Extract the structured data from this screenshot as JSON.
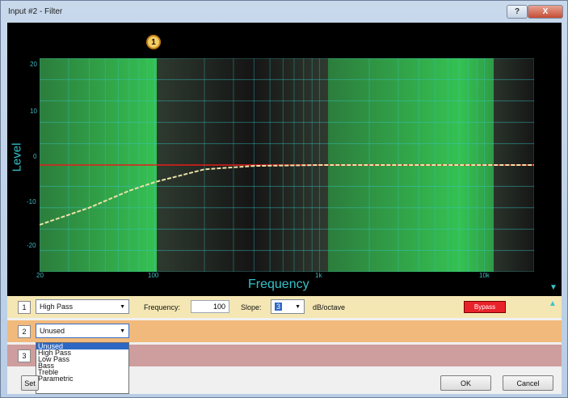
{
  "window": {
    "title": "Input #2 - Filter",
    "help_label": "?",
    "close_label": "X"
  },
  "plot": {
    "marker_label": "1",
    "y_axis_title": "Level",
    "x_axis_title": "Frequency",
    "y_ticks": [
      "20",
      "10",
      "0",
      "-10",
      "-20"
    ],
    "x_ticks": [
      "20",
      "100",
      "1k",
      "10k"
    ],
    "colors": {
      "background": "#000000",
      "band_green": "#31c954",
      "band_dark": "#222622",
      "grid": "#38c8ca",
      "flat_line": "#e51d1d",
      "response_curve": "#ece2a8"
    }
  },
  "filter_rows": [
    {
      "index": "1",
      "type": "High Pass",
      "frequency_label": "Frequency:",
      "frequency_value": "100",
      "slope_label": "Slope:",
      "slope_value": "3",
      "slope_unit": "dB/octave",
      "bypass_label": "Bypass"
    },
    {
      "index": "2",
      "type": "Unused"
    },
    {
      "index": "3"
    }
  ],
  "dropdown_options": [
    "Unused",
    "High Pass",
    "Low Pass",
    "Bass",
    "Treble",
    "Parametric"
  ],
  "footer": {
    "set_label": "Set",
    "ok_label": "OK",
    "cancel_label": "Cancel"
  },
  "chart_data": {
    "type": "line",
    "title": "",
    "xlabel": "Frequency",
    "ylabel": "Level",
    "x_scale": "log",
    "xlim": [
      20,
      20000
    ],
    "ylim": [
      -25,
      25
    ],
    "series": [
      {
        "x": [
          20,
          40,
          70,
          100,
          200,
          400,
          1000,
          10000,
          20000
        ],
        "values": [
          -14,
          -10,
          -6,
          -4,
          -1,
          -0.2,
          0,
          0,
          0
        ]
      },
      {
        "x": [
          20,
          20000
        ],
        "values": [
          0,
          0
        ]
      }
    ],
    "grid": true
  }
}
